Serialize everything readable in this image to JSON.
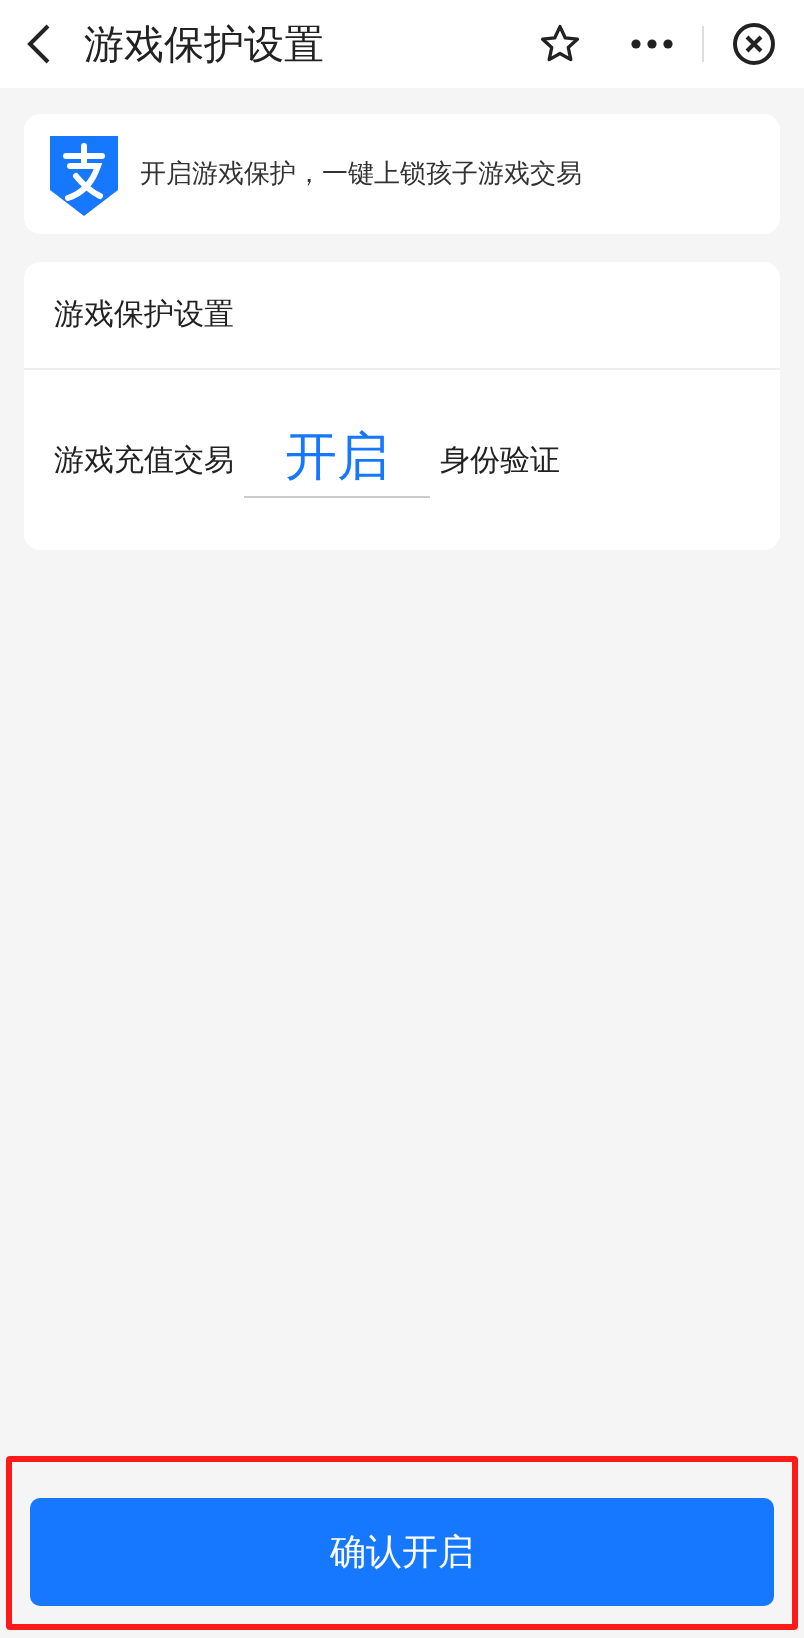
{
  "nav_bar": {
    "title": "游戏保护设置"
  },
  "notice": {
    "text": "开启游戏保护，一键上锁孩子游戏交易"
  },
  "settings_card": {
    "title": "游戏保护设置",
    "row": {
      "label": "游戏充值交易",
      "value": "开启",
      "suffix": "身份验证"
    }
  },
  "confirm_button": {
    "label": "确认开启",
    "highlighted": true
  }
}
